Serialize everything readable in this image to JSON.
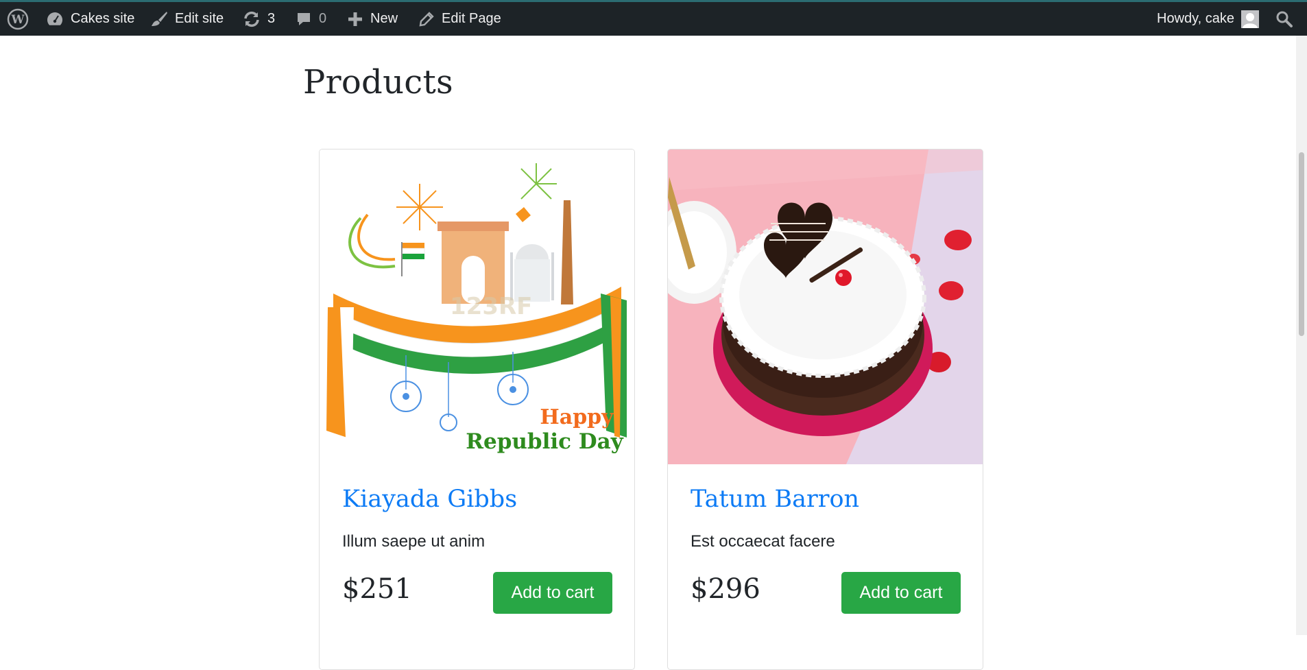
{
  "adminbar": {
    "wp_logo_icon": "wordpress-logo-icon",
    "site_name": "Cakes site",
    "edit_site": "Edit site",
    "updates_count": "3",
    "comments_count": "0",
    "new_label": "New",
    "edit_page": "Edit Page",
    "howdy": "Howdy, cake"
  },
  "page": {
    "title": "Products"
  },
  "products": [
    {
      "name": "Kiayada Gibbs",
      "description": "Illum saepe ut anim",
      "price": "$251",
      "button": "Add to cart",
      "image_banner_line1": "Happy",
      "image_banner_line2": "Republic Day",
      "image_watermark": "123RF"
    },
    {
      "name": "Tatum Barron",
      "description": "Est occaecat facere",
      "price": "$296",
      "button": "Add to cart"
    }
  ],
  "colors": {
    "adminbar_bg": "#1d2327",
    "link_blue": "#0d7bf5",
    "button_green": "#28a745"
  }
}
